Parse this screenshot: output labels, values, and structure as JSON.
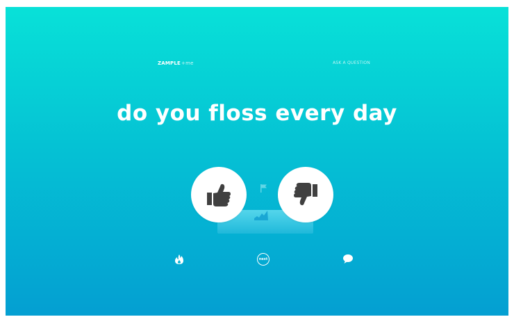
{
  "header": {
    "logo_main": "ZAMPLE",
    "logo_suffix": "+me",
    "ask_link": "ASK A QUESTION"
  },
  "question": {
    "text": "do you floss every day"
  },
  "bottom_bar": {
    "next_label": "next"
  },
  "icons": {
    "thumbs_up": "thumbs-up-icon",
    "thumbs_down": "thumbs-down-icon",
    "flag": "flag-icon",
    "trend": "trend-chart-icon",
    "hot": "fire-icon",
    "comment": "speech-bubble-icon"
  },
  "colors": {
    "background_top": "#08e1d8",
    "background_bottom": "#049fd2",
    "icon_dark": "#3f3f3f",
    "accent_light": "#8fe8f5"
  }
}
